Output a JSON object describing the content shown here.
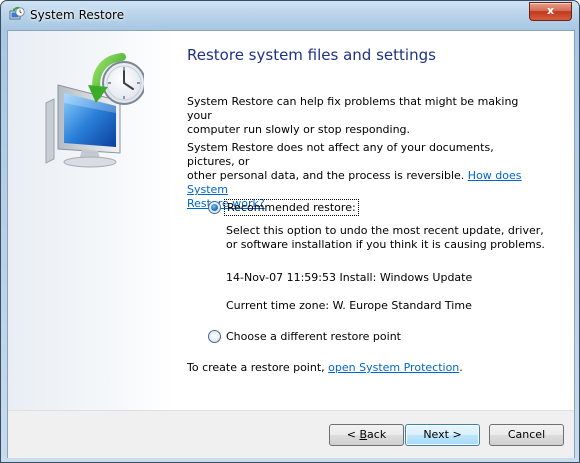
{
  "window": {
    "title": "System Restore",
    "close_label": "x"
  },
  "hero_icon": "system-restore-monitor-clock-icon",
  "main": {
    "heading": "Restore system files and settings",
    "intro_line1": "System Restore can help fix problems that might be making your",
    "intro_line2": "computer run slowly or stop responding.",
    "info_line1": "System Restore does not affect any of your documents, pictures, or",
    "info_line2_text": "other personal data, and the process is reversible. ",
    "info_link_part1": "How does System",
    "info_link_part2": "Restore work?",
    "options": {
      "recommended": {
        "label": "Recommended restore:",
        "selected": true,
        "desc_line1": "Select this option to undo the most recent update, driver,",
        "desc_line2": "or software installation if you think it is causing problems.",
        "restore_point": "14-Nov-07 11:59:53 Install: Windows Update",
        "timezone": "Current time zone: W. Europe Standard Time"
      },
      "different": {
        "label": "Choose a different restore point",
        "selected": false
      }
    },
    "protection_text": "To create a restore point, ",
    "protection_link": "open System Protection",
    "protection_suffix": "."
  },
  "footer": {
    "back_prefix": "< ",
    "back_mnemonic": "B",
    "back_rest": "ack",
    "next_label": "Next >",
    "cancel_label": "Cancel"
  },
  "colors": {
    "heading": "#1e3287",
    "link": "#0066cc",
    "close_button": "#c7412a"
  }
}
